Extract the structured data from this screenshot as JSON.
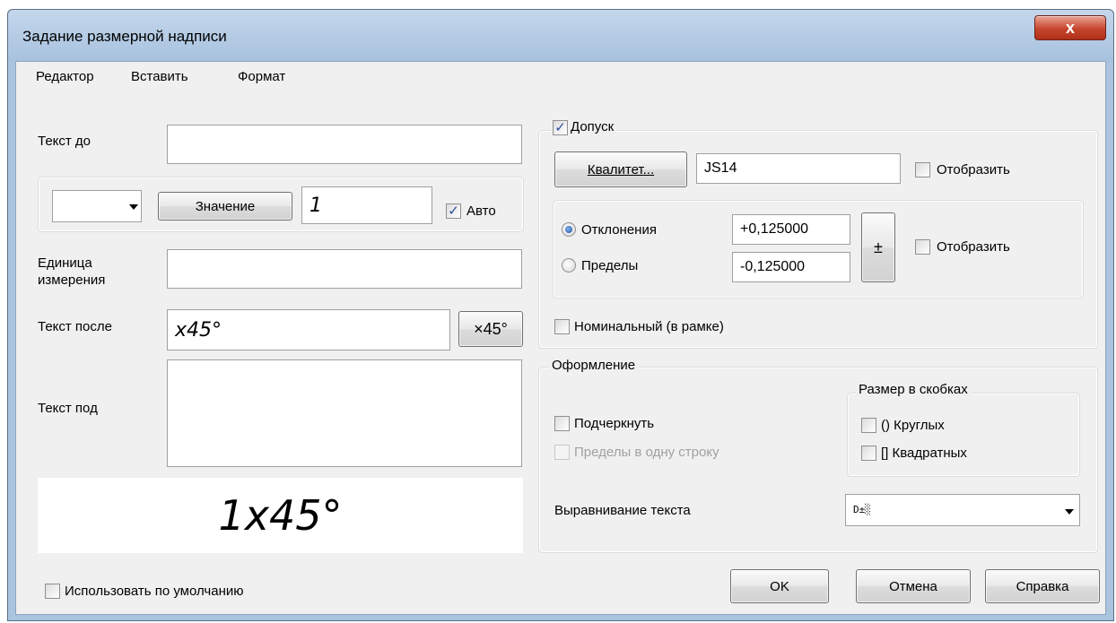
{
  "window": {
    "title": "Задание размерной надписи",
    "close_glyph": "x"
  },
  "menu": [
    "Редактор",
    "Вставить",
    "Формат"
  ],
  "left": {
    "text_before_label": "Текст до",
    "text_before_value": "",
    "symbol_select_value": "",
    "value_button": "Значение",
    "value_field": "1",
    "auto_label": "Авто",
    "auto_checked": true,
    "unit_label_line1": "Единица",
    "unit_label_line2": "измерения",
    "unit_value": "",
    "text_after_label": "Текст после",
    "text_after_value": "x45°",
    "x45_button": "×45°",
    "text_under_label": "Текст под",
    "text_under_value": "",
    "preview_text": "1x45°",
    "use_default_label": "Использовать по умолчанию"
  },
  "tolerance": {
    "label": "Допуск",
    "checked": true,
    "qualitet_button": "Квалитет...",
    "qualitet_value": "JS14",
    "show_label": "Отобразить",
    "deviations_label": "Отклонения",
    "limits_label": "Пределы",
    "upper_value": "+0,125000",
    "lower_value": "-0,125000",
    "plusminus_button": "±",
    "show2_label": "Отобразить",
    "nominal_label": "Номинальный (в рамке)"
  },
  "design": {
    "legend": "Оформление",
    "underline_label": "Подчеркнуть",
    "limits_one_line_label": "Пределы в одну строку",
    "brackets_legend": "Размер в скобках",
    "round_label": "() Круглых",
    "square_label": "[] Квадратных",
    "align_label": "Выравнивание текста",
    "align_value": "D±░"
  },
  "buttons": {
    "ok": "OK",
    "cancel": "Отмена",
    "help": "Справка"
  },
  "colors": {
    "title_bar": "#aac3de",
    "close_button": "#c7452d",
    "dialog_bg": "#f0f0f0"
  }
}
